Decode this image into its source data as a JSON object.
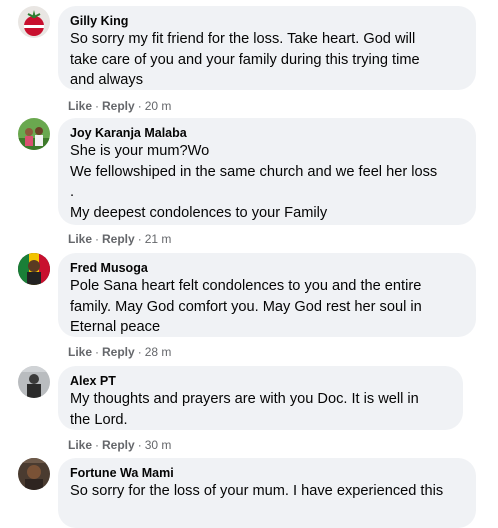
{
  "comments": [
    {
      "name": "Gilly King",
      "text": "So sorry my fit friend for the loss. Take heart. God will\ntake care of you and your family during this trying time\nand always",
      "like": "Like",
      "reply": "Reply",
      "time": "20 m"
    },
    {
      "name": "Joy Karanja Malaba",
      "text": "She is your mum?Wo\nWe fellowshiped in the same church and we feel her loss\n.\nMy deepest condolences to your Family",
      "like": "Like",
      "reply": "Reply",
      "time": "21 m"
    },
    {
      "name": "Fred Musoga",
      "text": "Pole Sana heart felt condolences to you and the entire\nfamily. May God comfort you. May God rest her soul in\nEternal peace",
      "like": "Like",
      "reply": "Reply",
      "time": "28 m"
    },
    {
      "name": "Alex PT",
      "text": "My thoughts and prayers are with you Doc. It is well in\nthe Lord.",
      "like": "Like",
      "reply": "Reply",
      "time": "30 m"
    },
    {
      "name": "Fortune Wa Mami",
      "text": "So sorry for the loss of your mum. I have experienced this",
      "like": "",
      "reply": "",
      "time": ""
    }
  ],
  "separator": "·"
}
